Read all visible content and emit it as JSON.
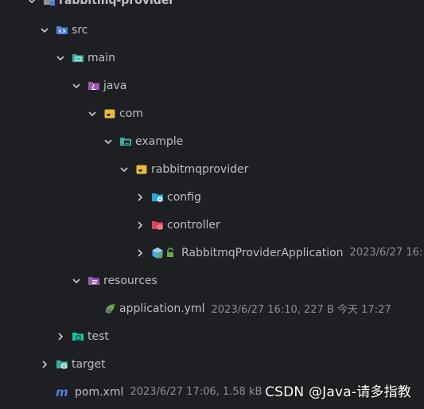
{
  "tree": {
    "project": {
      "label": "rabbitmq-provider"
    },
    "src": {
      "label": "src"
    },
    "main": {
      "label": "main"
    },
    "java": {
      "label": "java"
    },
    "com": {
      "label": "com"
    },
    "example": {
      "label": "example"
    },
    "rabbitmqprovider": {
      "label": "rabbitmqprovider"
    },
    "config": {
      "label": "config"
    },
    "controller": {
      "label": "controller"
    },
    "app_class": {
      "label": "RabbitmqProviderApplication",
      "meta": "2023/6/27 16:"
    },
    "resources": {
      "label": "resources"
    },
    "application_yml": {
      "label": "application.yml",
      "meta": "2023/6/27 16:10, 227 B 今天 17:27"
    },
    "test": {
      "label": "test"
    },
    "target": {
      "label": "target"
    },
    "pom": {
      "label": "pom.xml",
      "meta": "2023/6/27 17:06, 1.58 kB"
    }
  },
  "watermark": {
    "text": "CSDN @Java-请多指教"
  },
  "colors": {
    "background": "#1e1f22",
    "text": "#bcbec4",
    "meta": "#8b8e94",
    "folder_blue": "#4f7fd6",
    "folder_teal": "#3dab9f",
    "folder_purple": "#9b59b6",
    "folder_yellow": "#e9b93d",
    "folder_red": "#d5475e",
    "folder_cyan": "#22a8d9",
    "folder_green": "#1ec5a2"
  },
  "icons": {
    "src": "source-folder-icon",
    "main": "module-folder-icon",
    "java": "java-sources-folder-icon",
    "com": "package-folder-icon",
    "example": "image-package-folder-icon",
    "rabbitmqprovider": "package-folder-icon",
    "config": "config-folder-icon",
    "controller": "controller-folder-icon",
    "app_class": "spring-boot-class-icon",
    "resources": "resources-folder-icon",
    "application_yml": "spring-config-file-icon",
    "test": "test-folder-icon",
    "target": "target-folder-icon",
    "pom": "maven-icon"
  }
}
